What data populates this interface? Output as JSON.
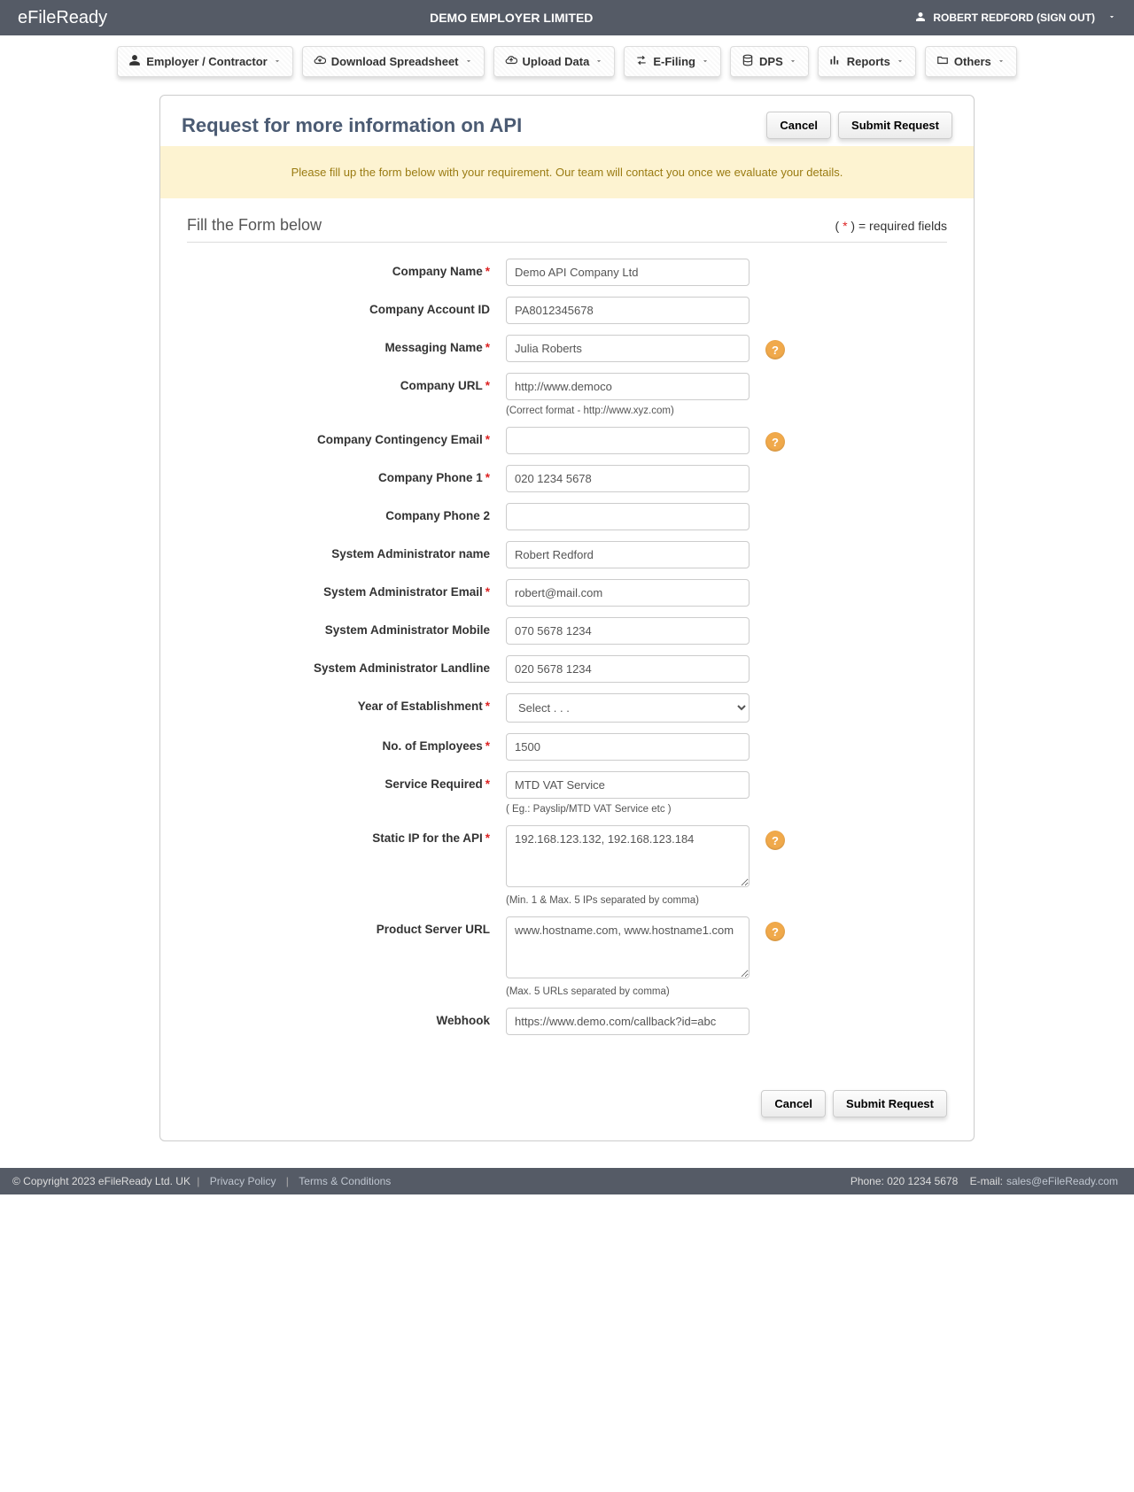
{
  "header": {
    "brand": "eFileReady",
    "company": "DEMO EMPLOYER LIMITED",
    "user_label": "ROBERT REDFORD (SIGN OUT)"
  },
  "nav": {
    "employer": "Employer / Contractor",
    "download": "Download Spreadsheet",
    "upload": "Upload Data",
    "efiling": "E-Filing",
    "dps": "DPS",
    "reports": "Reports",
    "others": "Others"
  },
  "panel": {
    "title": "Request for more information on API",
    "cancel": "Cancel",
    "submit": "Submit Request",
    "banner": "Please fill up the form below with your requirement. Our team will contact you once we evaluate your details."
  },
  "form_head": {
    "title": "Fill the Form below",
    "req_prefix": "( ",
    "req_ast": "*",
    "req_suffix": " ) = required fields"
  },
  "labels": {
    "company_name": "Company Name",
    "account_id": "Company Account ID",
    "messaging_name": "Messaging Name",
    "company_url": "Company URL",
    "url_hint": "(Correct format - http://www.xyz.com)",
    "contingency_email": "Company Contingency Email",
    "phone1": "Company Phone 1",
    "phone2": "Company Phone 2",
    "admin_name": "System Administrator name",
    "admin_email": "System Administrator Email",
    "admin_mobile": "System Administrator Mobile",
    "admin_landline": "System Administrator Landline",
    "year_est": "Year of Establishment",
    "employees": "No. of Employees",
    "service_required": "Service Required",
    "service_hint": "( Eg.: Payslip/MTD VAT Service etc )",
    "static_ip": "Static IP for the API",
    "ip_hint": "(Min. 1 & Max. 5 IPs separated by comma)",
    "server_url": "Product Server URL",
    "server_hint": "(Max. 5 URLs separated by comma)",
    "webhook": "Webhook"
  },
  "values": {
    "company_name": "Demo API Company Ltd",
    "account_id": "PA8012345678",
    "messaging_name": "Julia Roberts",
    "company_url": "http://www.democo",
    "contingency_email": "",
    "phone1": "020 1234 5678",
    "phone2": "",
    "admin_name": "Robert Redford",
    "admin_email": "robert@mail.com",
    "admin_mobile": "070 5678 1234",
    "admin_landline": "020 5678 1234",
    "year_select_placeholder": "Select . . .",
    "employees": "1500",
    "service_required": "MTD VAT Service",
    "static_ip": "192.168.123.132, 192.168.123.184",
    "server_url": "www.hostname.com, www.hostname1.com",
    "webhook": "https://www.demo.com/callback?id=abc"
  },
  "footer": {
    "copyright": "© Copyright 2023  eFileReady Ltd. UK",
    "privacy": "Privacy Policy",
    "terms": "Terms & Conditions",
    "phone_label": "Phone: ",
    "phone": "020 1234 5678",
    "email_label": "E-mail:",
    "email": "sales@eFileReady.com"
  }
}
